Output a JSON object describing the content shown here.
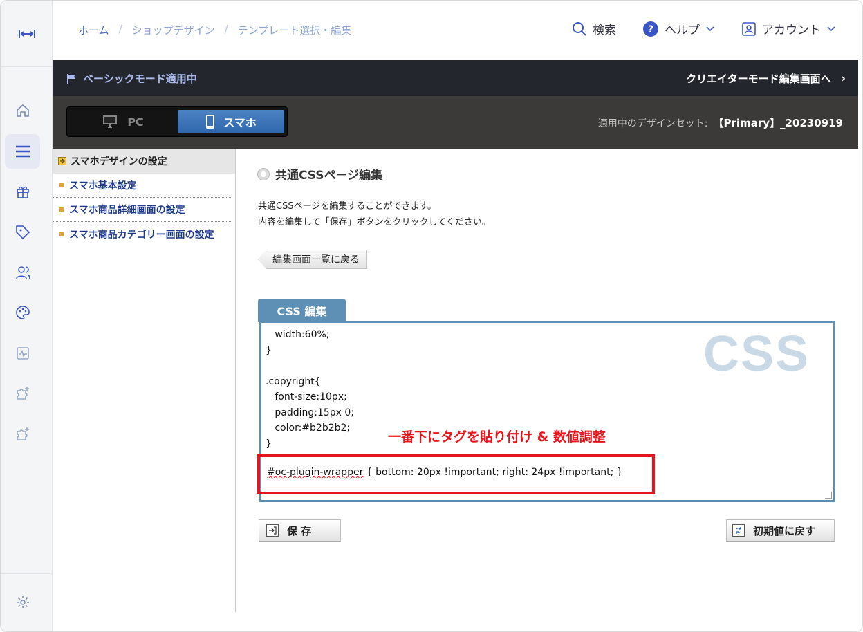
{
  "rail": {
    "logo_icon": "expand-horizontal-icon",
    "items": [
      "home-icon",
      "menu-icon",
      "gift-icon",
      "tag-icon",
      "users-icon",
      "palette-icon",
      "analytics-icon",
      "puzzle-plus-icon",
      "puzzle-plus-icon"
    ],
    "settings_icon": "gear-icon"
  },
  "breadcrumb": {
    "home": "ホーム",
    "sep": "/",
    "level2": "ショップデザイン",
    "level3": "テンプレート選択・編集"
  },
  "top_actions": {
    "search": "検索",
    "help": "ヘルプ",
    "account": "アカウント"
  },
  "modebar": {
    "mode_label": "ベーシックモード適用中",
    "creator_link": "クリエイターモード編集画面へ",
    "chevron": "›"
  },
  "device": {
    "pc": "PC",
    "smartphone": "スマホ",
    "designset_label": "適用中のデザインセット:",
    "designset_value": "【Primary】_20230919"
  },
  "subnav": {
    "header": "スマホデザインの設定",
    "items": [
      "スマホ基本設定",
      "スマホ商品詳細画面の設定",
      "スマホ商品カテゴリー画面の設定"
    ]
  },
  "main": {
    "title": "共通CSSページ編集",
    "desc_line1": "共通CSSページを編集することができます。",
    "desc_line2": "内容を編集して「保存」ボタンをクリックしてください。",
    "back_button": "編集画面一覧に戻る",
    "tab_label": "CSS 編集",
    "watermark": "CSS",
    "code": "   width:60%;\n}\n\n.copyright{\n   font-size:10px;\n   padding:15px 0;\n   color:#b2b2b2;\n}",
    "highlight_selector": "#oc-plugin-wrapper",
    "highlight_rest": " { bottom: 20px !important; right: 24px !important; }",
    "annotation": "一番下にタグを貼り付け & 数値調整",
    "save_button": "保 存",
    "reset_button": "初期値に戻す"
  },
  "colors": {
    "accent_blue": "#2f67ac",
    "editor_border": "#5e8fb4",
    "annotation_red": "#e8141b",
    "dark_bar": "#23262d"
  }
}
